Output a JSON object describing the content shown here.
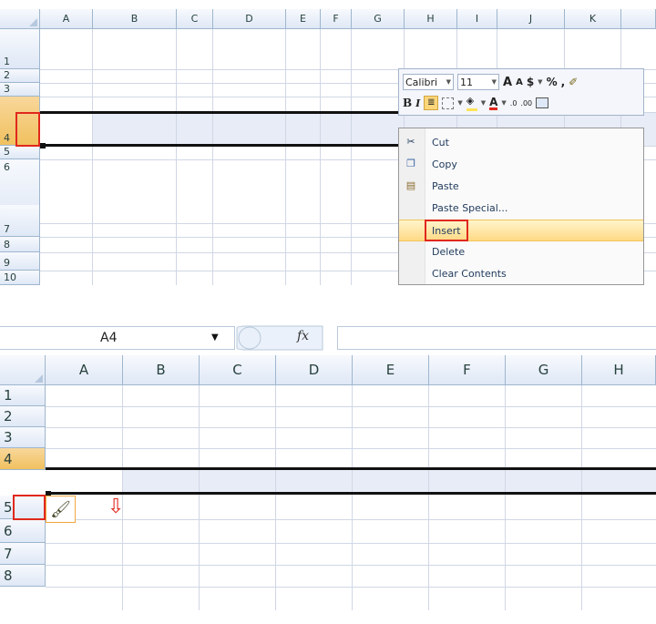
{
  "panel1": {
    "columns": [
      "A",
      "B",
      "C",
      "D",
      "E",
      "F",
      "G",
      "H",
      "I",
      "J",
      "K"
    ],
    "rows": [
      "1",
      "2",
      "3",
      "4",
      "5",
      "6",
      "7",
      "8",
      "9",
      "10"
    ],
    "mini_toolbar": {
      "font_name": "Calibri",
      "font_size": "11",
      "grow_font": "A",
      "shrink_font": "A",
      "currency": "$",
      "percent": "%",
      "comma": ",",
      "bold": "B",
      "italic": "I",
      "font_color": "A",
      "increase_decimal": ".0",
      "decrease_decimal": ".00"
    },
    "context_menu": {
      "items": [
        {
          "label": "Cut",
          "icon": "scissors-icon"
        },
        {
          "label": "Copy",
          "icon": "copy-icon"
        },
        {
          "label": "Paste",
          "icon": "paste-icon"
        },
        {
          "label": "Paste Special...",
          "icon": ""
        },
        {
          "label": "Insert",
          "icon": ""
        },
        {
          "label": "Delete",
          "icon": ""
        },
        {
          "label": "Clear Contents",
          "icon": ""
        }
      ]
    }
  },
  "panel2": {
    "name_box": "A4",
    "fx": "fx",
    "formula": "",
    "columns": [
      "A",
      "B",
      "C",
      "D",
      "E",
      "F",
      "G",
      "H"
    ],
    "rows": [
      "1",
      "2",
      "3",
      "4",
      "5",
      "6",
      "7",
      "8"
    ],
    "arrow": "⇩"
  },
  "colors": {
    "highlight_red": "#e0281d",
    "selected_header": "#f1c15f",
    "menu_hover": "#ffd985",
    "selected_row_fill": "#e8ecf6"
  }
}
